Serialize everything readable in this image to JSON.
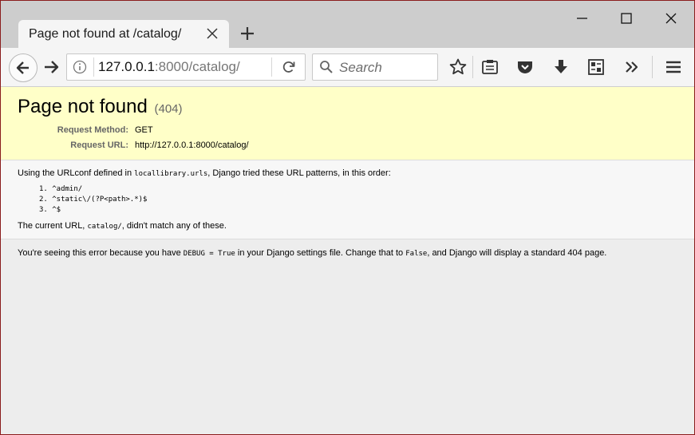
{
  "tab": {
    "title": "Page not found at /catalog/"
  },
  "url": {
    "host": "127.0.0.1",
    "rest": ":8000/catalog/"
  },
  "search": {
    "placeholder": "Search"
  },
  "error": {
    "title": "Page not found",
    "code": "(404)",
    "method_label": "Request Method:",
    "method_value": "GET",
    "url_label": "Request URL:",
    "url_value": "http://127.0.0.1:8000/catalog/"
  },
  "info": {
    "intro_before": "Using the URLconf defined in",
    "intro_code": "locallibrary.urls",
    "intro_after": ", Django tried these URL patterns, in this order:",
    "patterns": [
      "1. ^admin/",
      "2. ^static\\/(?P<path>.*)$",
      "3. ^$"
    ],
    "nomatch_before": "The current URL,",
    "nomatch_code": "catalog/",
    "nomatch_after": ", didn't match any of these."
  },
  "explanation": {
    "part1": "You're seeing this error because you have",
    "code1": "DEBUG = True",
    "part2": "in your Django settings file. Change that to",
    "code2": "False",
    "part3": ", and Django will display a standard 404 page."
  },
  "colors": {
    "summary_bg": "#ffffc8",
    "titlebar_bg": "#cdcdcd",
    "window_border": "#8a1c1c"
  },
  "icons": [
    "close-tab-icon",
    "new-tab-icon",
    "minimize-icon",
    "maximize-icon",
    "close-window-icon",
    "back-icon",
    "forward-icon",
    "info-icon",
    "reload-icon",
    "search-icon",
    "bookmark-star-icon",
    "reader-view-icon",
    "pocket-icon",
    "download-icon",
    "library-icon",
    "overflow-icon",
    "hamburger-menu-icon"
  ]
}
